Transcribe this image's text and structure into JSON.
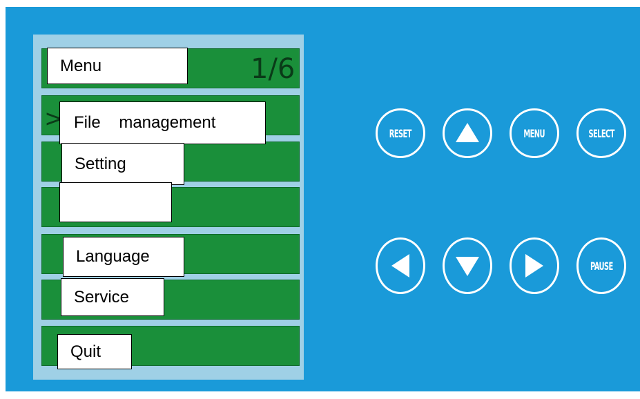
{
  "menu": {
    "title": "Menu",
    "page_indicator": "1/6",
    "cursor_glyph": ">",
    "items": [
      {
        "label": "File    management"
      },
      {
        "label": "Setting"
      },
      {
        "label": ""
      },
      {
        "label": "Language"
      },
      {
        "label": "Service"
      },
      {
        "label": "Quit"
      }
    ]
  },
  "buttons": {
    "reset": "RESET",
    "menu": "MENU",
    "select": "SELECT",
    "pause": "PAUSE",
    "up_icon": "triangle-up-icon",
    "down_icon": "triangle-down-icon",
    "left_icon": "triangle-left-icon",
    "right_icon": "triangle-right-icon"
  },
  "colors": {
    "panel": "#1a9ad9",
    "screen_frame": "#9fd0e6",
    "row_green": "#1a8f3a",
    "button_outline": "#ffffff"
  }
}
